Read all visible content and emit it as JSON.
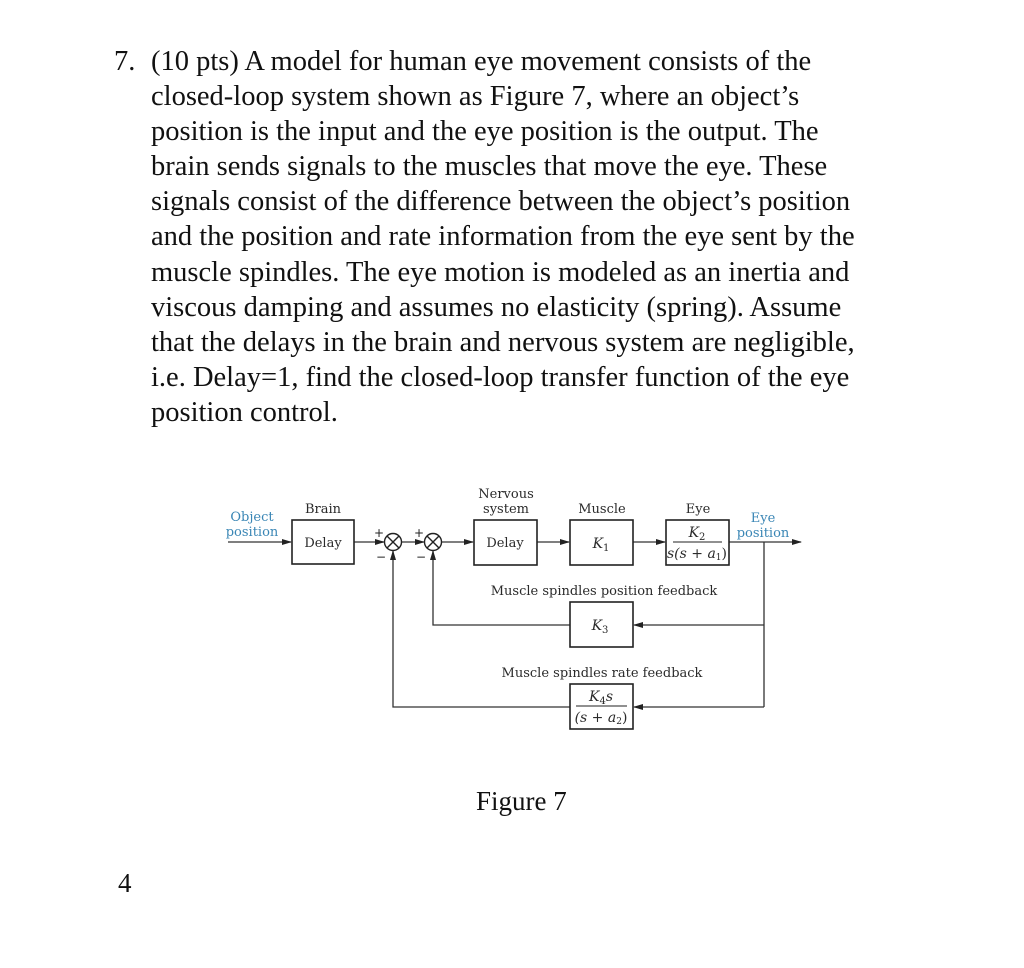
{
  "problem": {
    "number": "7.",
    "lines": [
      "(10 pts) A model for human eye movement consists of the",
      "closed-loop system shown as Figure 7, where an object’s",
      "position is the input and the eye position is the output. The",
      "brain sends signals to the muscles that move the eye.  These",
      "signals consist of the difference between the object’s position",
      "and the position and rate information from the eye sent by the",
      "muscle spindles. The eye motion is modeled as an inertia and",
      "viscous damping and assumes no elasticity (spring). Assume",
      "that the delays in the brain and nervous system are negligible,",
      "i.e. Delay=1, find the closed-loop transfer function of the eye",
      "position control."
    ]
  },
  "diagram": {
    "input_label": [
      "Object",
      "position"
    ],
    "output_label": [
      "Eye",
      "position"
    ],
    "blocks": {
      "brain": {
        "title": "Brain",
        "content": "Delay"
      },
      "nervous": {
        "title": [
          "Nervous",
          "system"
        ],
        "content": "Delay"
      },
      "muscle": {
        "title": "Muscle",
        "content_main": "K",
        "content_sub": "1"
      },
      "eye": {
        "title": "Eye",
        "num_main": "K",
        "num_sub": "2",
        "den": "s(s + a",
        "den_sub": "1",
        "den_end": ")"
      },
      "k3": {
        "title": "Muscle spindles position feedback",
        "content_main": "K",
        "content_sub": "3"
      },
      "k4": {
        "title": "Muscle spindles rate feedback",
        "num_main": "K",
        "num_sub": "4",
        "num_end": "s",
        "den": "(s + a",
        "den_sub": "2",
        "den_end": ")"
      }
    },
    "summing_junctions": [
      {
        "plus": "+",
        "minus": "−"
      },
      {
        "plus": "+",
        "minus": "−"
      }
    ],
    "colors": {
      "signal_label": "#3a86b5",
      "line": "#333333"
    }
  },
  "caption": "Figure 7",
  "page_number": "4"
}
